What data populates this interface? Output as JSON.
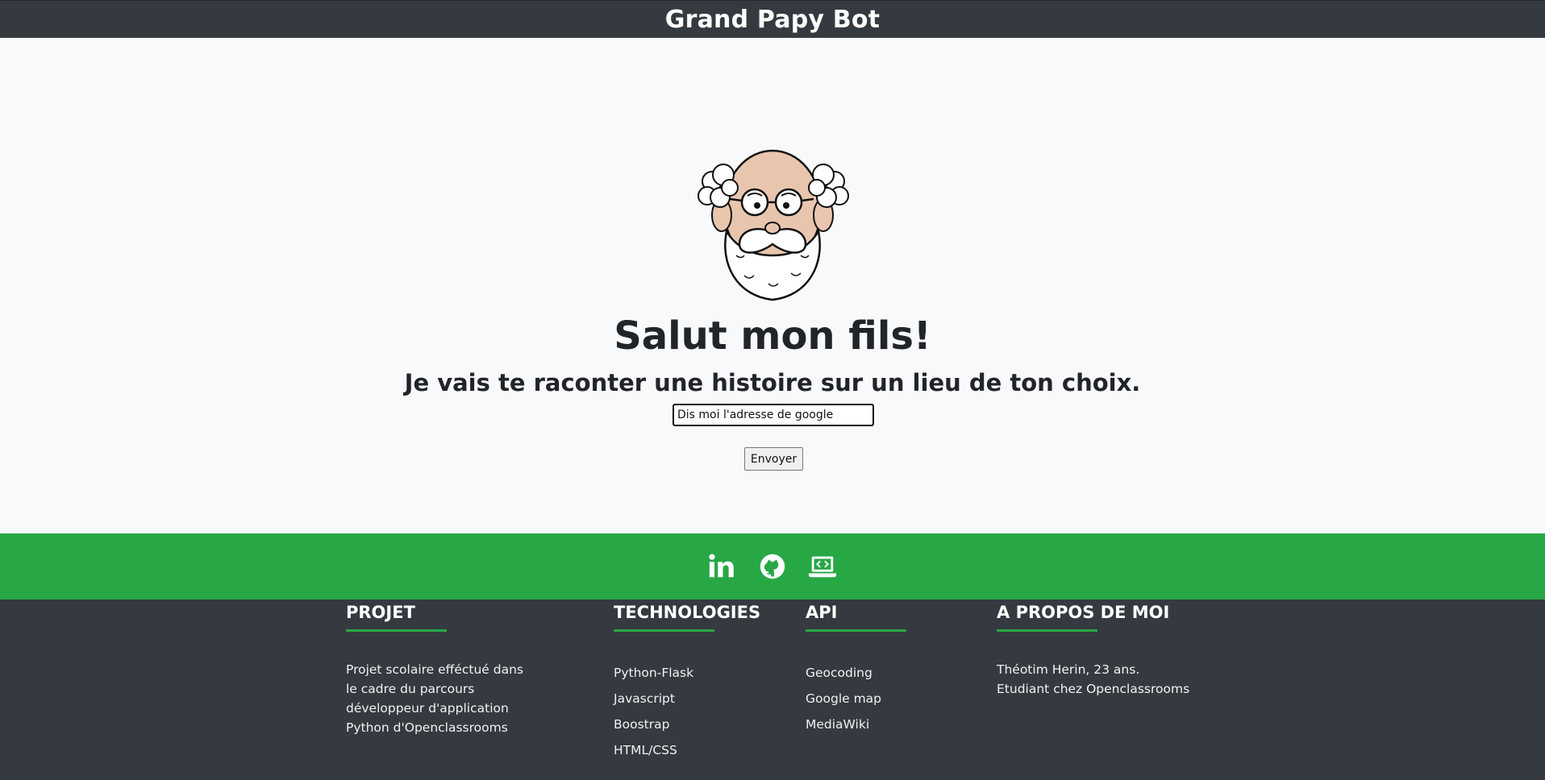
{
  "navbar": {
    "brand": "Grand Papy Bot"
  },
  "hero": {
    "title": "Salut mon fils!",
    "subtitle": "Je vais te raconter une histoire sur un lieu de ton choix.",
    "input_value": "Dis moi l'adresse de google",
    "submit_label": "Envoyer",
    "avatar_icon": "grandpa-face-icon"
  },
  "social": {
    "icons": [
      "linkedin-icon",
      "github-icon",
      "laptop-code-icon"
    ]
  },
  "footer": {
    "project": {
      "heading": "PROJET",
      "text": "Projet scolaire efféctué dans le cadre du parcours développeur d'application Python d'Openclassrooms"
    },
    "technologies": {
      "heading": "TECHNOLOGIES",
      "items": [
        "Python-Flask",
        "Javascript",
        "Boostrap",
        "HTML/CSS"
      ]
    },
    "api": {
      "heading": "API",
      "items": [
        "Geocoding",
        "Google map",
        "MediaWiki"
      ]
    },
    "about": {
      "heading": "A PROPOS DE MOI",
      "text": "Théotim Herin, 23 ans. Etudiant chez Openclassrooms"
    }
  },
  "colors": {
    "navbar": "#343a40",
    "accent_green": "#28a745",
    "page_background": "#f8f9fa"
  }
}
